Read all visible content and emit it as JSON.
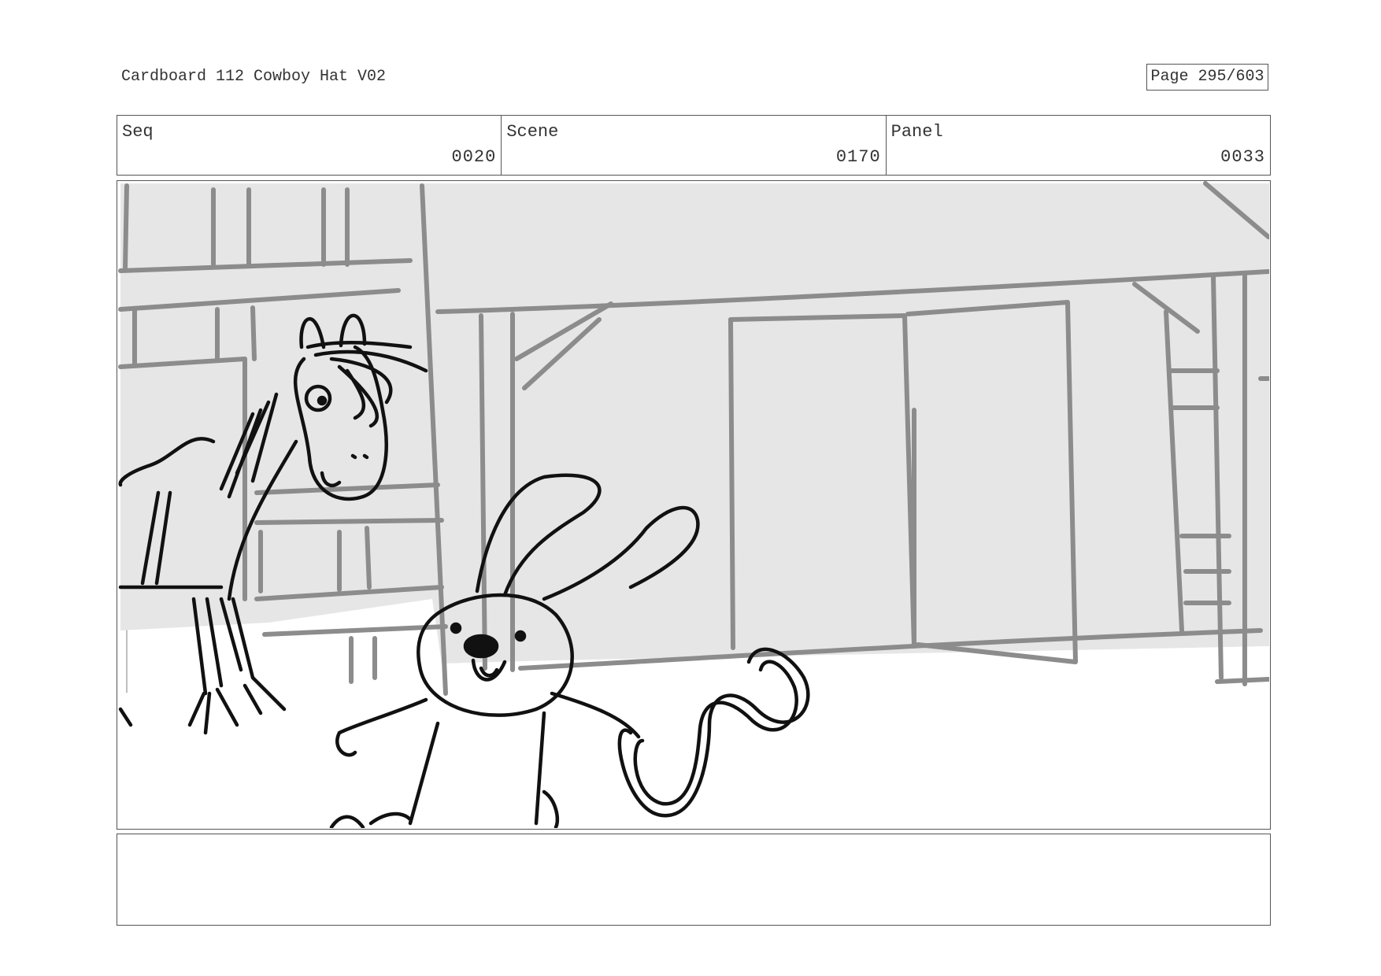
{
  "header": {
    "title": "Cardboard 112 Cowboy Hat V02",
    "page": "Page 295/603"
  },
  "info": {
    "seq_label": "Seq",
    "seq_value": "0020",
    "scene_label": "Scene",
    "scene_value": "0170",
    "panel_label": "Panel",
    "panel_value": "0033"
  },
  "panel_drawing": {
    "subject": "sketch of horse and rabbit in front of a barn",
    "colors": {
      "line": "#111111",
      "background_tone": "#e6e6e6",
      "structure_line": "#8c8c8c"
    }
  },
  "notes": {
    "text": ""
  }
}
